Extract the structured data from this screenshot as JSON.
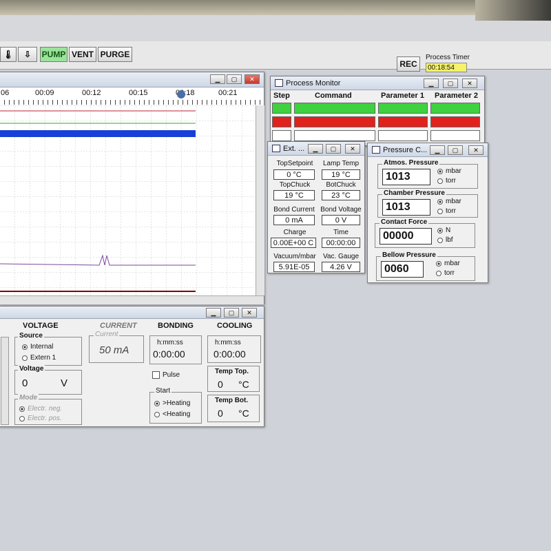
{
  "toolbar": {
    "buttons": [
      "PUMP",
      "VENT",
      "PURGE"
    ],
    "rec_label": "REC",
    "timer_label": "Process Timer",
    "timer_value": "00:18:54"
  },
  "chart_window": {
    "ticks": [
      "06",
      "00:09",
      "00:12",
      "00:15",
      "00:18",
      "00:21"
    ]
  },
  "process_monitor": {
    "title": "Process Monitor",
    "headers": [
      "Step",
      "Command",
      "Parameter 1",
      "Parameter 2"
    ]
  },
  "ext_window": {
    "title": "Ext. ...",
    "top_setpoint": {
      "label": "TopSetpoint",
      "value": "0 °C"
    },
    "lamp_temp": {
      "label": "Lamp Temp",
      "value": "19 °C"
    },
    "top_chuck": {
      "label": "TopChuck",
      "value": "19 °C"
    },
    "bot_chuck": {
      "label": "BotChuck",
      "value": "23 °C"
    },
    "bond_current": {
      "label": "Bond Current",
      "value": "0 mA"
    },
    "bond_voltage": {
      "label": "Bond Voltage",
      "value": "0 V"
    },
    "charge": {
      "label": "Charge",
      "value": "0.00E+00 C"
    },
    "time": {
      "label": "Time",
      "value": "00:00:00"
    },
    "vacuum": {
      "label": "Vacuum/mbar",
      "value": "5.91E-05"
    },
    "vac_gauge": {
      "label": "Vac. Gauge",
      "value": "4.26 V"
    }
  },
  "pressure_window": {
    "title": "Pressure C...",
    "atmos": {
      "label": "Atmos. Pressure",
      "value": "1013",
      "u1": "mbar",
      "u2": "torr"
    },
    "chamber": {
      "label": "Chamber Pressure",
      "value": "1013",
      "u1": "mbar",
      "u2": "torr"
    },
    "contact": {
      "label": "Contact Force",
      "value": "00000",
      "u1": "N",
      "u2": "lbf"
    },
    "bellow": {
      "label": "Bellow Pressure",
      "value": "0060",
      "u1": "mbar",
      "u2": "torr"
    }
  },
  "control_panel": {
    "voltage": {
      "header": "VOLTAGE",
      "source": "Source",
      "internal": "Internal",
      "extern": "Extern 1",
      "voltage_label": "Voltage",
      "voltage_value": "0",
      "voltage_unit": "V",
      "mode": "Mode",
      "neg": "Electr. neg.",
      "pos": "Electr. pos."
    },
    "current": {
      "header": "CURRENT",
      "label": "Current",
      "value": "50 mA"
    },
    "bonding": {
      "header": "BONDING",
      "hms": "h:mm:ss",
      "time": "0:00:00",
      "pulse": "Pulse",
      "start": "Start",
      "heat_up": ">Heating",
      "heat_down": "<Heating"
    },
    "cooling": {
      "header": "COOLING",
      "hms": "h:mm:ss",
      "time": "0:00:00",
      "temp_top": "Temp Top.",
      "temp_top_val": "0",
      "temp_bot": "Temp Bot.",
      "temp_bot_val": "0",
      "unit": "°C"
    }
  },
  "colors": {
    "green": "#3fd13f",
    "red": "#e0221d",
    "blue": "#1a3fd6"
  }
}
